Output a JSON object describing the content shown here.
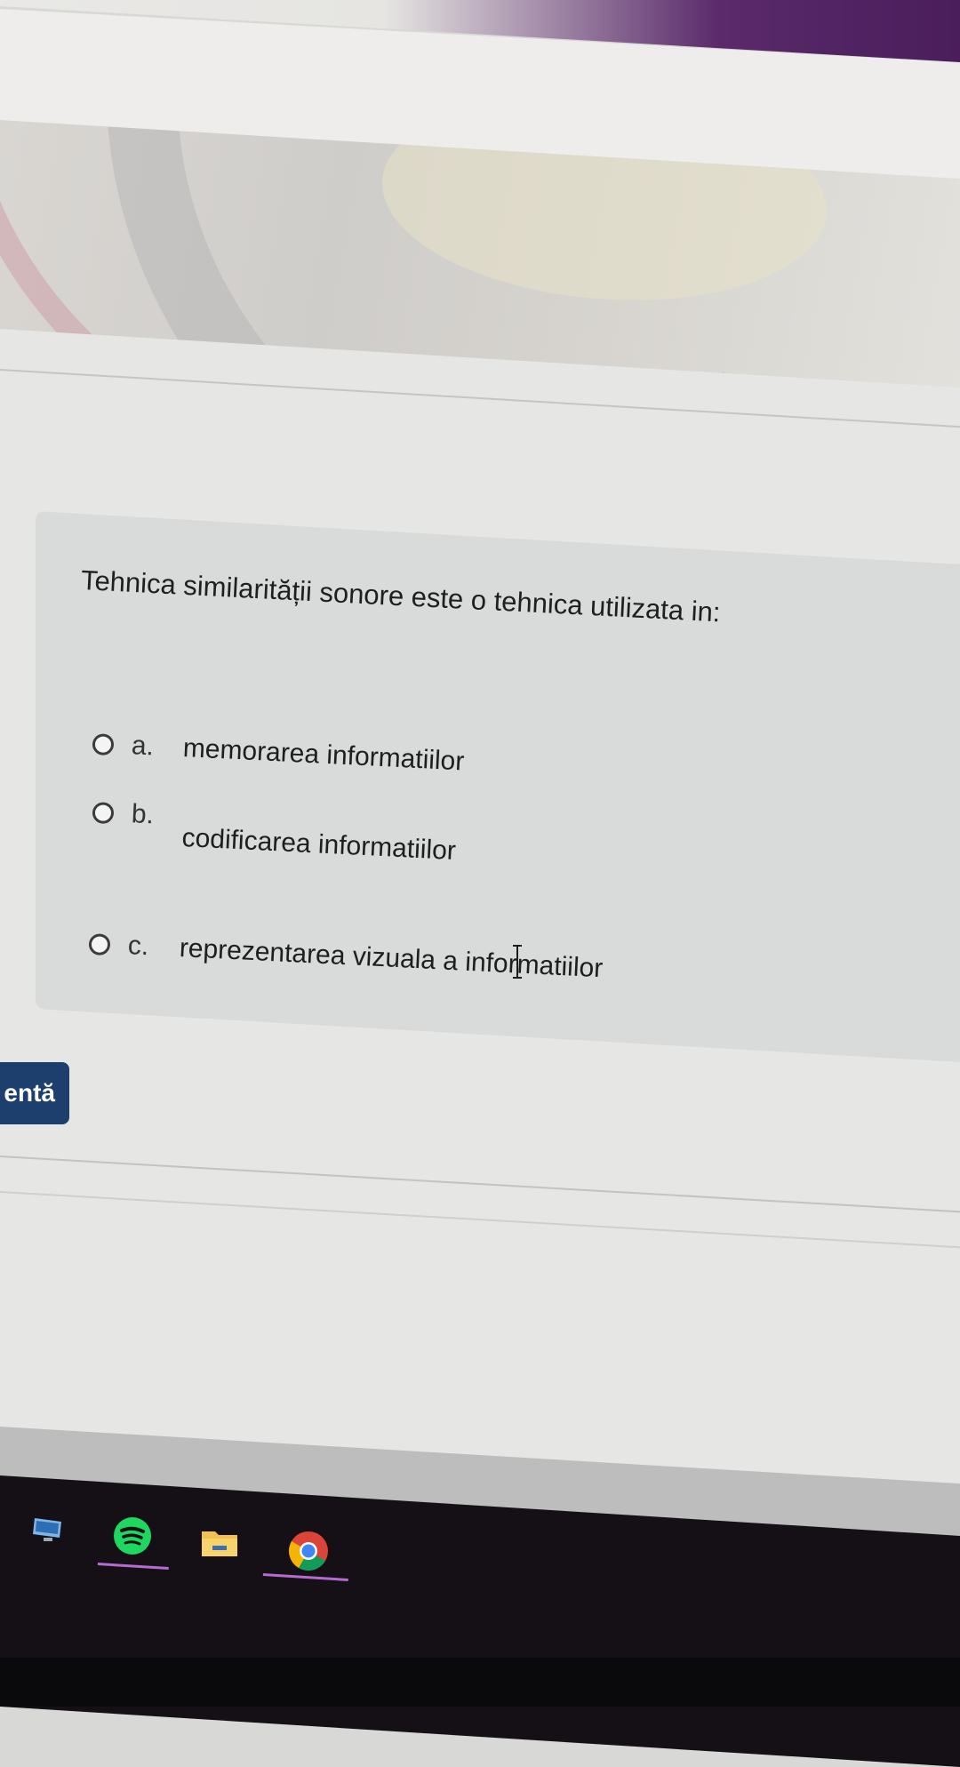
{
  "question": {
    "text": "Tehnica similarității sonore este o tehnica utilizata in:",
    "options": [
      {
        "letter": "a.",
        "text": "memorarea informatiilor"
      },
      {
        "letter": "b.",
        "text": "codificarea informatiilor"
      },
      {
        "letter": "c.",
        "text": "reprezentarea vizuala a informatiilor"
      }
    ]
  },
  "nav": {
    "button_label": "entă"
  },
  "taskbar": {
    "icons": [
      "computer-icon",
      "spotify-icon",
      "file-explorer-icon",
      "chrome-icon"
    ],
    "accent_color": "#b76bd0"
  },
  "colors": {
    "nav_button": "#1c3f6e",
    "top_bar_purple": "#4a1d5b"
  }
}
